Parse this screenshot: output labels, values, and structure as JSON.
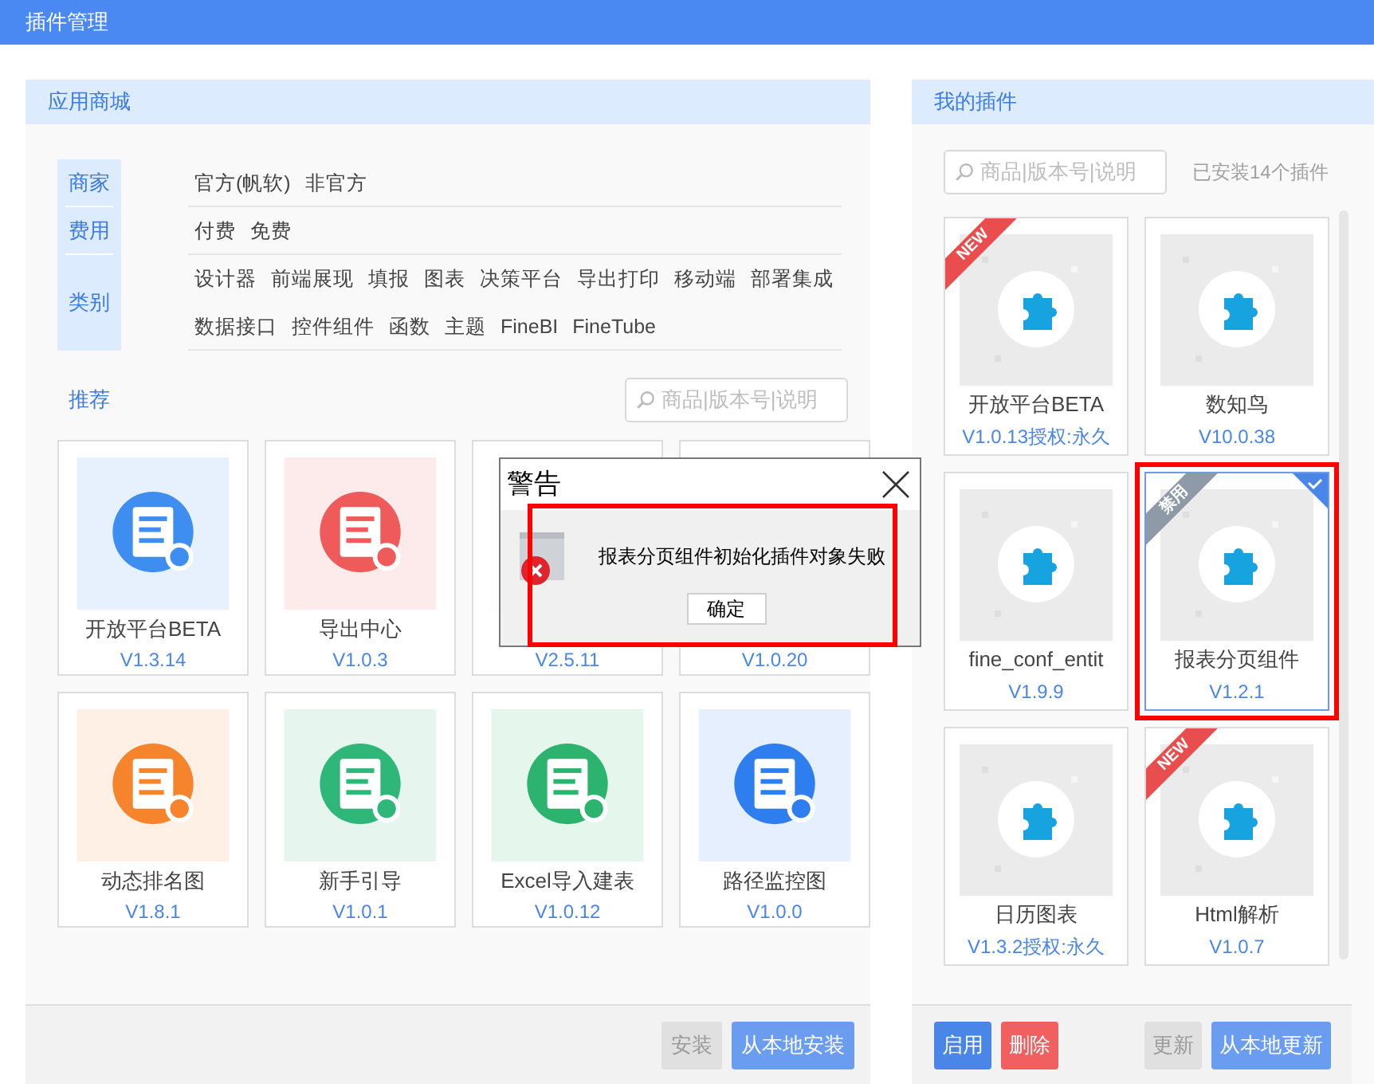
{
  "window": {
    "title": "插件管理"
  },
  "store": {
    "title": "应用商城",
    "filters": [
      {
        "label": "商家",
        "options": [
          "官方(帆软)",
          "非官方"
        ]
      },
      {
        "label": "费用",
        "options": [
          "付费",
          "免费"
        ]
      },
      {
        "label": "类别",
        "options": [
          "设计器",
          "前端展现",
          "填报",
          "图表",
          "决策平台",
          "导出打印",
          "移动端",
          "部署集成",
          "数据接口",
          "控件组件",
          "函数",
          "主题",
          "FineBI",
          "FineTube"
        ]
      }
    ],
    "recommend_label": "推荐",
    "search": {
      "placeholder": "商品|版本号|说明"
    },
    "items": [
      {
        "name": "开放平台BETA",
        "version": "V1.3.14",
        "color": "#3d8ef0"
      },
      {
        "name": "导出中心",
        "version": "V1.0.3",
        "color": "#ef5a5a"
      },
      {
        "version": "V2.5.11"
      },
      {
        "version": "V1.0.20"
      },
      {
        "name": "动态排名图",
        "version": "V1.8.1",
        "color": "#f5842c"
      },
      {
        "name": "新手引导",
        "version": "V1.0.1",
        "color": "#2fb77a"
      },
      {
        "name": "Excel导入建表",
        "version": "V1.0.12",
        "color": "#2cb46e"
      },
      {
        "name": "路径监控图",
        "version": "V1.0.0",
        "color": "#2f7ef0"
      }
    ],
    "buttons": [
      {
        "label": "安装",
        "disabled": true
      },
      {
        "label": "从本地安装",
        "disabled": false
      }
    ]
  },
  "my_plugins": {
    "title": "我的插件",
    "search": {
      "placeholder": "商品|版本号|说明"
    },
    "installed_count": "已安装14个插件",
    "items": [
      {
        "name": "开放平台BETA",
        "version": "V1.0.13授权:永久",
        "ribbon": {
          "text": "NEW",
          "color": "#ea4d4d"
        },
        "selected": false
      },
      {
        "name": "数知鸟",
        "version": "V10.0.38",
        "selected": false
      },
      {
        "name": "fine_conf_entit",
        "version": "V1.9.9",
        "selected": false
      },
      {
        "name": "报表分页组件",
        "version": "V1.2.1",
        "ribbon": {
          "text": "禁用",
          "color": "#8e9aa8"
        },
        "selected": true
      },
      {
        "name": "日历图表",
        "version": "V1.3.2授权:永久",
        "selected": false
      },
      {
        "name": "Html解析",
        "version": "V1.0.7",
        "ribbon": {
          "text": "NEW",
          "color": "#ea4d4d"
        },
        "selected": false
      }
    ],
    "buttons": [
      {
        "label": "启用",
        "kind": "primary"
      },
      {
        "label": "删除",
        "kind": "danger"
      },
      {
        "label": "更新",
        "kind": "disabled"
      },
      {
        "label": "从本地更新",
        "kind": "secondary"
      }
    ]
  },
  "dialog": {
    "title": "警告",
    "message": "报表分页组件初始化插件对象失败",
    "button": "确定",
    "highlighted": true
  }
}
